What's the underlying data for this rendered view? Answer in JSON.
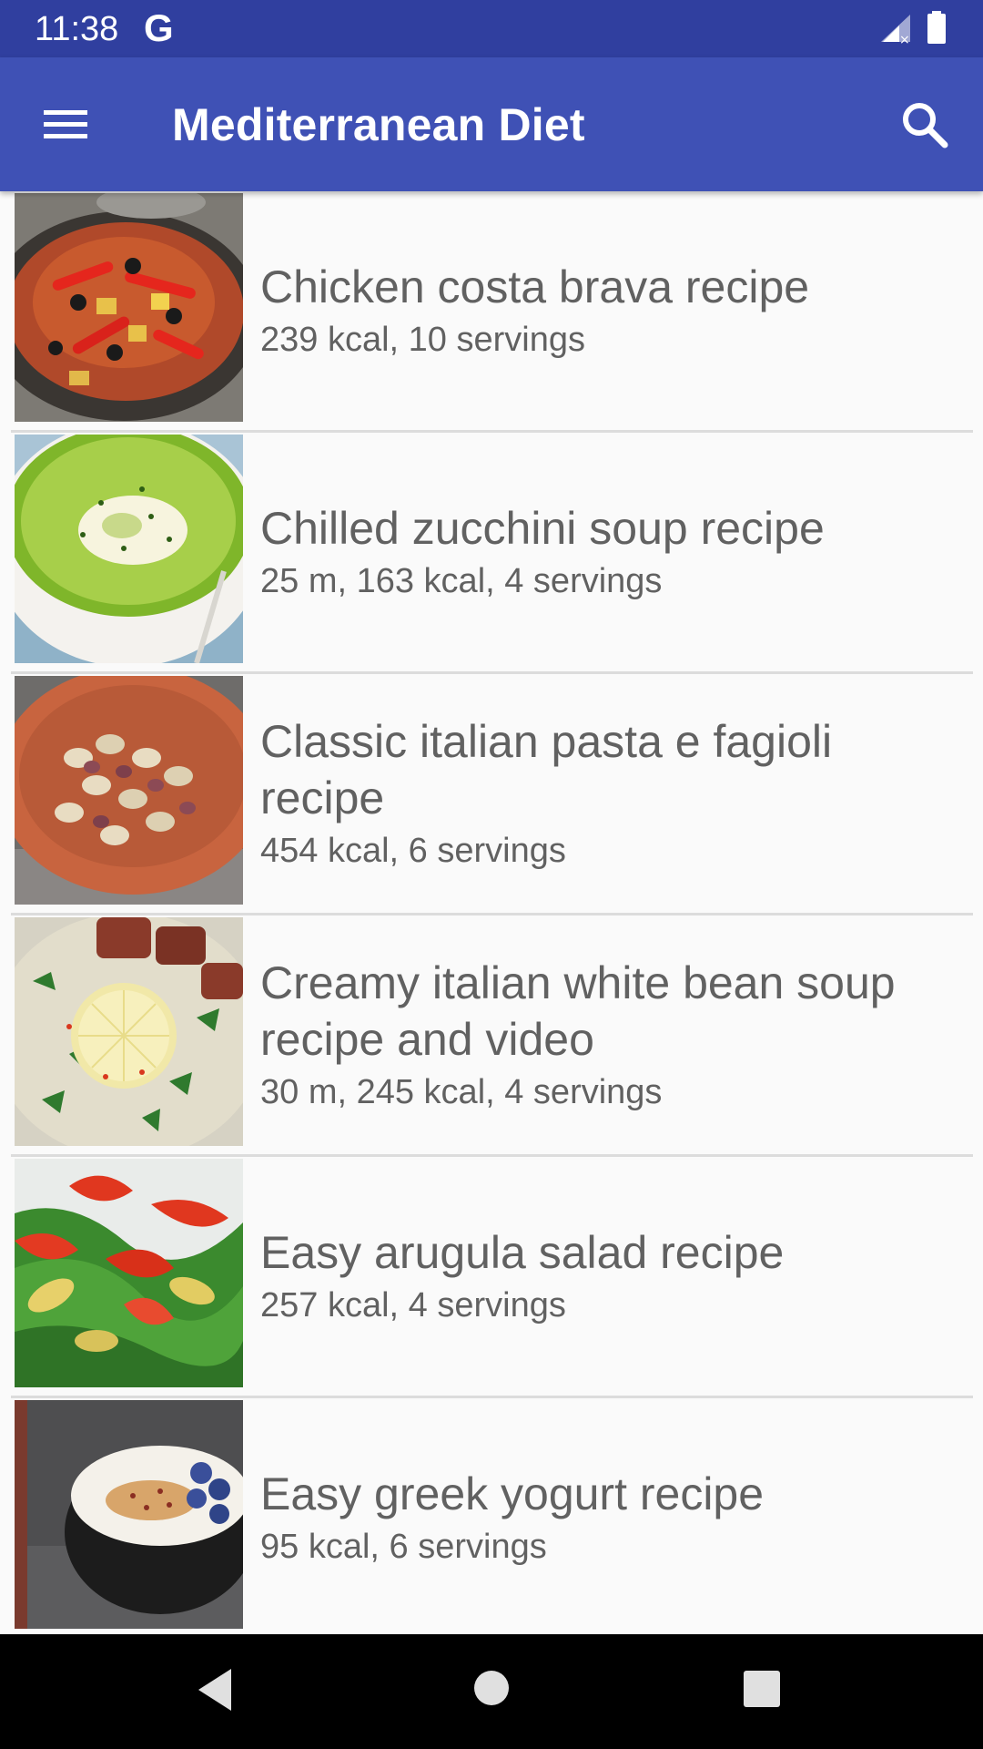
{
  "status_bar": {
    "time": "11:38",
    "notification_icon": "G",
    "icons": [
      "signal-icon",
      "battery-icon"
    ]
  },
  "app_bar": {
    "title": "Mediterranean Diet",
    "menu_icon": "hamburger-menu-icon",
    "search_icon": "search-icon",
    "color": "#3f51b5",
    "status_color": "#303f9f"
  },
  "recipes": [
    {
      "title": "Chicken costa brava recipe",
      "details": "239 kcal, 10 servings",
      "thumbnail": "chicken-stew-pan-image"
    },
    {
      "title": "Chilled zucchini soup recipe",
      "details": "25 m, 163 kcal, 4 servings",
      "thumbnail": "green-soup-bowl-image"
    },
    {
      "title": "Classic italian pasta e fagioli recipe",
      "details": "454 kcal, 6 servings",
      "thumbnail": "pasta-bean-bowl-image"
    },
    {
      "title": "Creamy italian white bean soup recipe and video",
      "details": "30 m, 245 kcal, 4 servings",
      "thumbnail": "white-bean-soup-image"
    },
    {
      "title": "Easy arugula salad recipe",
      "details": "257 kcal, 4 servings",
      "thumbnail": "arugula-salad-image"
    },
    {
      "title": "Easy greek yogurt recipe",
      "details": "95 kcal, 6 servings",
      "thumbnail": "greek-yogurt-bowl-image"
    }
  ],
  "nav_bar": {
    "icons": [
      "back-icon",
      "home-icon",
      "recents-icon"
    ]
  }
}
